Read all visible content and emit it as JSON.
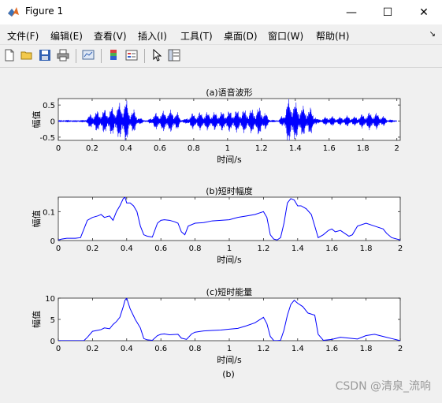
{
  "window": {
    "title": "Figure 1",
    "minimize_glyph": "—",
    "maximize_glyph": "☐",
    "close_glyph": "✕"
  },
  "menu": {
    "items": [
      "文件(F)",
      "编辑(E)",
      "查看(V)",
      "插入(I)",
      "工具(T)",
      "桌面(D)",
      "窗口(W)",
      "帮助(H)"
    ],
    "overflow_glyph": "↘"
  },
  "toolbar": {
    "icons": [
      "new-figure-icon",
      "open-file-icon",
      "save-icon",
      "print-icon",
      "link-plot-icon",
      "colorbar-icon",
      "legend-icon",
      "pointer-icon",
      "property-editor-icon"
    ]
  },
  "figure": {
    "caption": "(b)",
    "watermark": "CSDN @清泉_流响",
    "line_color": "#0000ff"
  },
  "chart_data": [
    {
      "type": "line",
      "title": "(a)语音波形",
      "xlabel": "时间/s",
      "ylabel": "幅值",
      "xlim": [
        0,
        2.02
      ],
      "ylim": [
        -0.6,
        0.7
      ],
      "xticks": [
        "0",
        "0.2",
        "0.4",
        "0.6",
        "0.8",
        "1",
        "1.2",
        "1.4",
        "1.6",
        "1.8",
        "2"
      ],
      "yticks": [
        "-0.5",
        "0",
        "0.5"
      ],
      "envelope": {
        "x": [
          0,
          0.05,
          0.1,
          0.15,
          0.17,
          0.2,
          0.25,
          0.3,
          0.35,
          0.38,
          0.4,
          0.42,
          0.45,
          0.48,
          0.5,
          0.53,
          0.56,
          0.6,
          0.65,
          0.7,
          0.72,
          0.75,
          0.78,
          0.8,
          0.85,
          0.9,
          0.95,
          1.0,
          1.05,
          1.1,
          1.15,
          1.2,
          1.25,
          1.27,
          1.3,
          1.33,
          1.35,
          1.38,
          1.4,
          1.45,
          1.5,
          1.53,
          1.57,
          1.6,
          1.65,
          1.7,
          1.75,
          1.8,
          1.85,
          1.9,
          1.95,
          2.0
        ],
        "amp": [
          0.02,
          0.03,
          0.02,
          0.03,
          0.1,
          0.25,
          0.3,
          0.35,
          0.45,
          0.55,
          0.6,
          0.35,
          0.3,
          0.1,
          0.05,
          0.02,
          0.2,
          0.25,
          0.3,
          0.28,
          0.08,
          0.05,
          0.2,
          0.22,
          0.25,
          0.24,
          0.25,
          0.28,
          0.3,
          0.32,
          0.33,
          0.4,
          0.05,
          0.03,
          0.02,
          0.2,
          0.55,
          0.65,
          0.5,
          0.4,
          0.35,
          0.05,
          0.1,
          0.15,
          0.1,
          0.15,
          0.12,
          0.2,
          0.25,
          0.2,
          0.05,
          0.02
        ]
      }
    },
    {
      "type": "line",
      "title": "(b)短时幅度",
      "xlabel": "时间/s",
      "ylabel": "幅值",
      "xlim": [
        0,
        2
      ],
      "ylim": [
        0,
        0.15
      ],
      "xticks": [
        "0",
        "0.2",
        "0.4",
        "0.6",
        "0.8",
        "1",
        "1.2",
        "1.4",
        "1.6",
        "1.8",
        "2"
      ],
      "yticks": [
        "0",
        "0.1"
      ],
      "x": [
        0,
        0.02,
        0.05,
        0.1,
        0.13,
        0.15,
        0.17,
        0.2,
        0.23,
        0.25,
        0.27,
        0.3,
        0.32,
        0.34,
        0.36,
        0.38,
        0.39,
        0.4,
        0.42,
        0.44,
        0.46,
        0.48,
        0.5,
        0.52,
        0.55,
        0.58,
        0.6,
        0.62,
        0.65,
        0.68,
        0.7,
        0.72,
        0.74,
        0.76,
        0.8,
        0.85,
        0.9,
        0.95,
        1.0,
        1.05,
        1.1,
        1.15,
        1.2,
        1.22,
        1.24,
        1.26,
        1.28,
        1.3,
        1.32,
        1.34,
        1.36,
        1.38,
        1.4,
        1.42,
        1.45,
        1.48,
        1.5,
        1.52,
        1.55,
        1.58,
        1.6,
        1.62,
        1.65,
        1.7,
        1.72,
        1.75,
        1.8,
        1.85,
        1.9,
        1.92,
        1.95,
        2.0
      ],
      "y": [
        0.002,
        0.005,
        0.008,
        0.008,
        0.01,
        0.04,
        0.07,
        0.08,
        0.085,
        0.09,
        0.08,
        0.085,
        0.07,
        0.1,
        0.12,
        0.145,
        0.15,
        0.13,
        0.13,
        0.12,
        0.1,
        0.05,
        0.02,
        0.015,
        0.012,
        0.06,
        0.07,
        0.072,
        0.07,
        0.065,
        0.06,
        0.03,
        0.02,
        0.05,
        0.06,
        0.062,
        0.068,
        0.07,
        0.072,
        0.08,
        0.085,
        0.09,
        0.1,
        0.08,
        0.02,
        0.005,
        0.002,
        0.01,
        0.06,
        0.13,
        0.145,
        0.14,
        0.12,
        0.12,
        0.11,
        0.09,
        0.05,
        0.01,
        0.02,
        0.035,
        0.04,
        0.03,
        0.035,
        0.015,
        0.02,
        0.05,
        0.06,
        0.05,
        0.04,
        0.025,
        0.01,
        0.002
      ]
    },
    {
      "type": "line",
      "title": "(c)短时能量",
      "xlabel": "时间/s",
      "ylabel": "幅值",
      "xlim": [
        0,
        2
      ],
      "ylim": [
        0,
        10
      ],
      "xticks": [
        "0",
        "0.2",
        "0.4",
        "0.6",
        "0.8",
        "1",
        "1.2",
        "1.4",
        "1.6",
        "1.8",
        "2"
      ],
      "yticks": [
        "0",
        "5",
        "10"
      ],
      "x": [
        0,
        0.05,
        0.1,
        0.15,
        0.17,
        0.2,
        0.25,
        0.27,
        0.3,
        0.32,
        0.34,
        0.36,
        0.38,
        0.39,
        0.4,
        0.42,
        0.45,
        0.48,
        0.5,
        0.52,
        0.55,
        0.58,
        0.6,
        0.62,
        0.65,
        0.7,
        0.72,
        0.75,
        0.78,
        0.8,
        0.85,
        0.9,
        0.95,
        1.0,
        1.05,
        1.1,
        1.15,
        1.2,
        1.22,
        1.24,
        1.26,
        1.28,
        1.3,
        1.32,
        1.34,
        1.36,
        1.38,
        1.4,
        1.43,
        1.46,
        1.5,
        1.52,
        1.55,
        1.6,
        1.65,
        1.7,
        1.75,
        1.8,
        1.85,
        1.9,
        1.95,
        2.0
      ],
      "y": [
        0.02,
        0.02,
        0.02,
        0.03,
        0.8,
        2.2,
        2.6,
        3.0,
        2.8,
        3.8,
        4.5,
        5.5,
        8.0,
        9.5,
        10.0,
        7.5,
        5.0,
        3.0,
        0.5,
        0.2,
        0.1,
        1.2,
        1.5,
        1.6,
        1.4,
        1.5,
        0.6,
        0.3,
        1.6,
        2.0,
        2.3,
        2.4,
        2.5,
        2.7,
        2.9,
        3.5,
        4.2,
        5.5,
        4.0,
        1.0,
        0.05,
        0.02,
        0.1,
        2.5,
        6.0,
        8.5,
        9.5,
        8.8,
        8.0,
        6.5,
        6.0,
        1.5,
        0.1,
        0.3,
        0.8,
        0.6,
        0.4,
        1.2,
        1.5,
        1.0,
        0.5,
        0.02
      ]
    }
  ]
}
